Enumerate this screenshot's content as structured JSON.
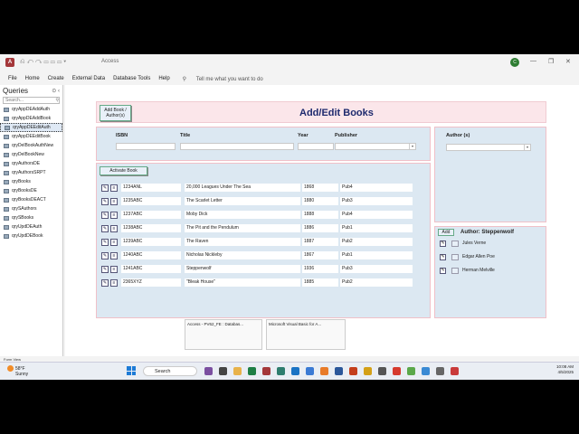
{
  "app": {
    "title": "Access",
    "user_initials": "C"
  },
  "menu": [
    "File",
    "Home",
    "Create",
    "External Data",
    "Database Tools",
    "Help"
  ],
  "tell_me": "Tell me what you want to do",
  "nav": {
    "header": "Queries",
    "search_placeholder": "Search...",
    "items": [
      "qryAppDEAddAuth",
      "qryAppDEAddBook",
      "qryAppDEEditAuth",
      "qryAppDEEditBook",
      "qryDelBookAuthNew",
      "qryDelBookNew",
      "qryAuthorsDE",
      "qryAuthorsSRPT",
      "qryBooks",
      "qryBooksDE",
      "qryBooksDEACT",
      "qrySAuthors",
      "qrySBooks",
      "qryUpdDEAuth",
      "qryUpdDEBook"
    ]
  },
  "form": {
    "add_button": "Add Book / Author(s)",
    "title": "Add/Edit Books",
    "labels": {
      "isbn": "ISBN",
      "title": "Title",
      "year": "Year",
      "publisher": "Publisher",
      "authors": "Author (s)"
    },
    "activate_button": "Activate Book",
    "books": [
      {
        "isbn": "1234ANL",
        "title": "20,000 Leagues Under The Sea",
        "year": "1868",
        "pub": "Pub4"
      },
      {
        "isbn": "1235ABC",
        "title": "The Scarlet Letter",
        "year": "1880",
        "pub": "Pub3"
      },
      {
        "isbn": "1237ABC",
        "title": "Moby Dick",
        "year": "1888",
        "pub": "Pub4"
      },
      {
        "isbn": "1238ABC",
        "title": "The Pit and the Pendulum",
        "year": "1886",
        "pub": "Pub1"
      },
      {
        "isbn": "1239ABC",
        "title": "The Raven",
        "year": "1887",
        "pub": "Pub2"
      },
      {
        "isbn": "1240ABC",
        "title": "Nicholas Nickleby",
        "year": "1867",
        "pub": "Pub1"
      },
      {
        "isbn": "1241ABC",
        "title": "Steppenwolf",
        "year": "1936",
        "pub": "Pub3"
      },
      {
        "isbn": "2365XYZ",
        "title": "\"Bleak House\"",
        "year": "1885",
        "pub": "Pub2"
      }
    ],
    "author_panel": {
      "add_label": "Add",
      "heading": "Author: Steppenwolf",
      "authors": [
        "Jules Verne",
        "Edgar Allen Poe",
        "Herman Melville"
      ]
    }
  },
  "status": "Form View",
  "taskbar": {
    "weather_temp": "58°F",
    "weather_desc": "Sunny",
    "search": "Search",
    "thumb1": "Access - PV62_FE : Databas...",
    "thumb2": "Microsoft Visual Basic for A...",
    "time": "10:08 AM",
    "date": "4/5/2025"
  }
}
